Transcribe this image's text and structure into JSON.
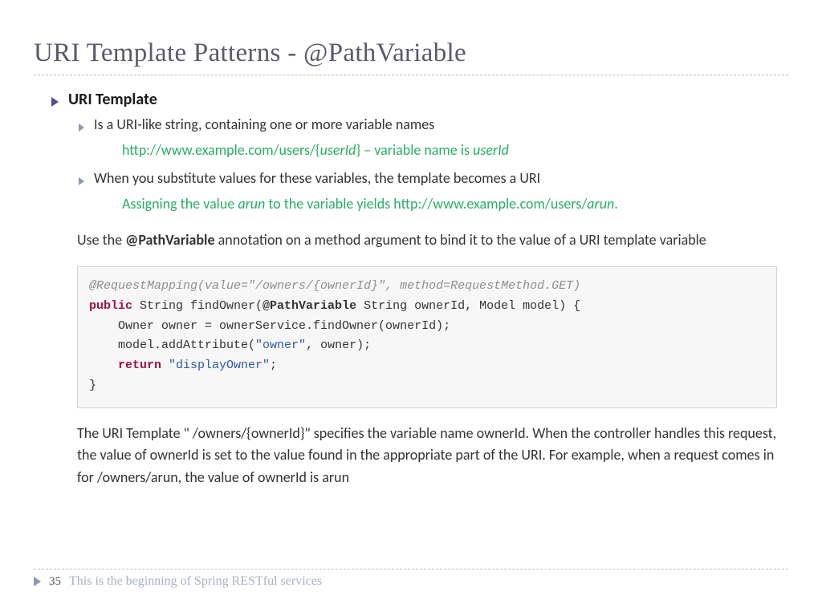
{
  "title": "URI Template Patterns - @PathVariable",
  "bullets": {
    "l1": "URI Template",
    "l2a": "Is a URI-like string, containing one or more variable names",
    "sub_a_pre": "http://www.example.com/users/{",
    "sub_a_var1": "userId",
    "sub_a_mid": "} – variable name is ",
    "sub_a_var2": "userId",
    "l2b": "When you substitute values for these variables, the template becomes a URI",
    "sub_b_pre": "Assigning the value ",
    "sub_b_var1": "arun",
    "sub_b_mid": " to the variable yields http://www.example.com/users/",
    "sub_b_var2": "arun",
    "sub_b_post": "."
  },
  "para1_pre": "Use the ",
  "para1_strong": "@PathVariable",
  "para1_post": " annotation on a method argument to bind it to the value of a URI template variable",
  "code": {
    "anno_pre": "@RequestMapping",
    "anno_post": "(value=\"/owners/{ownerId}\", method=RequestMethod.GET)",
    "kw_public": "public",
    "sig_pre": " String findOwner(",
    "sig_bold": "@PathVariable",
    "sig_post": " String ownerId, Model model) {",
    "l3": "    Owner owner = ownerService.findOwner(ownerId);",
    "l4_pre": "    model.addAttribute(",
    "l4_str": "\"owner\"",
    "l4_post": ", owner);",
    "kw_return": "return",
    "l5_pre": "    ",
    "l5_str": " \"displayOwner\"",
    "l5_post": ";",
    "l6": "}"
  },
  "para2": "The URI Template \" /owners/{ownerId}\" specifies the variable name ownerId. When the controller handles this request, the value of ownerId is set to the value found in the appropriate part of the URI. For example, when a request comes in for /owners/arun, the value of ownerId is arun",
  "footer": {
    "page": "35",
    "text": "This is the beginning of Spring RESTful services"
  }
}
